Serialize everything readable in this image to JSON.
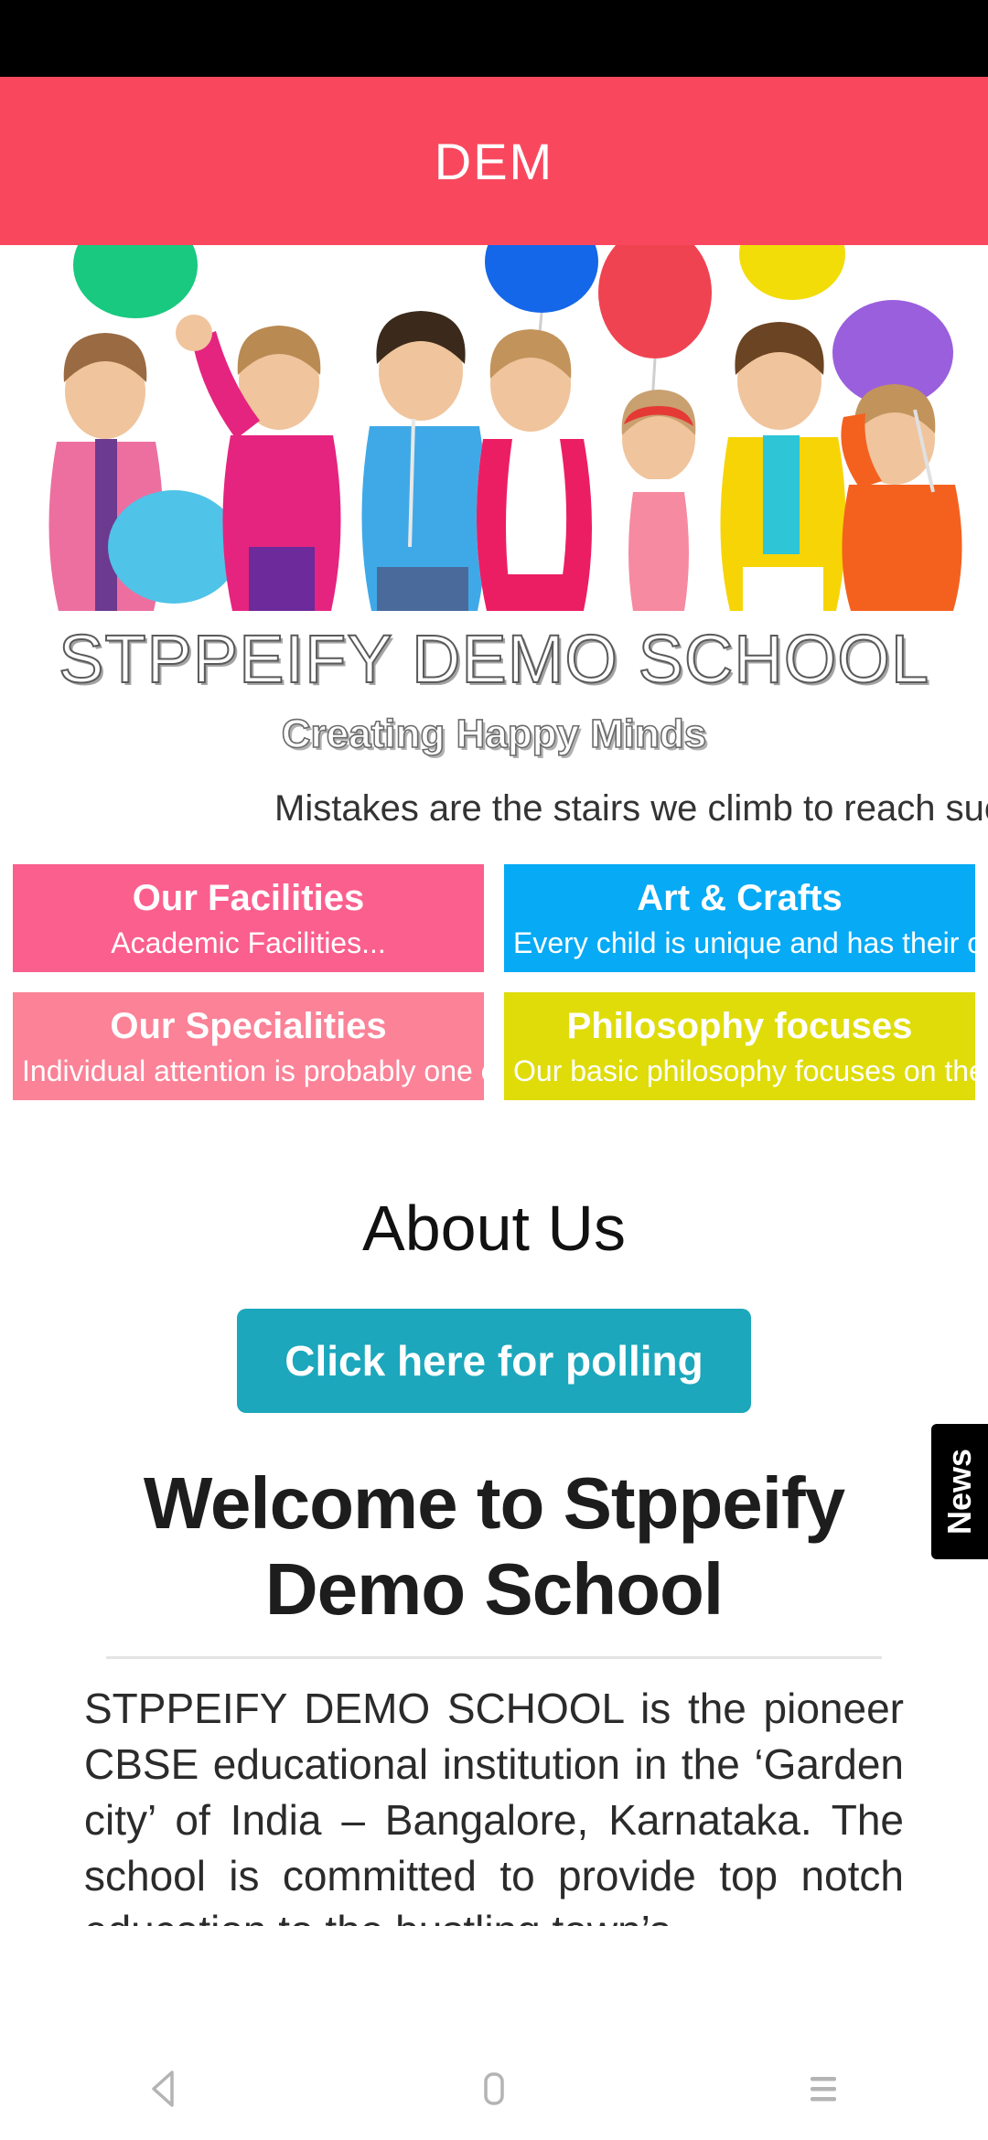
{
  "status_bar": {
    "present": true
  },
  "header": {
    "title": "DEM",
    "background_color": "#f9485e",
    "text_color": "#ffffff"
  },
  "banner": {
    "alt": "seven smiling children holding colorful balloons",
    "background_color": "#ffffff"
  },
  "identity": {
    "school_name": "STPPEIFY DEMO SCHOOL",
    "tagline": "Creating Happy Minds",
    "marquee": "Mistakes are the stairs we climb to reach suc"
  },
  "tiles": [
    {
      "title": "Our Facilities",
      "subtitle": "Academic Facilities...",
      "color": "#fb5f8e"
    },
    {
      "title": "Art & Crafts",
      "subtitle": "Every child is unique and has their ow",
      "color": "#06aaf5"
    },
    {
      "title": "Our Specialities",
      "subtitle": "Individual attention is probably one of",
      "color": "#fb8297"
    },
    {
      "title": "Philosophy focuses",
      "subtitle": "Our basic philosophy focuses on the s",
      "color": "#dfdc09"
    }
  ],
  "about": {
    "heading": "About Us",
    "poll_button": "Click here for polling",
    "poll_button_color": "#1ca7bc",
    "welcome_heading": "Welcome to Stppeify Demo School",
    "body": "STPPEIFY DEMO SCHOOL is the pioneer CBSE educational institution in the ‘Garden city’ of India – Bangalore, Karnataka. The school is committed to provide top notch education to the bustling town’s"
  },
  "news_tab": {
    "label": "News",
    "background_color": "#000000"
  },
  "nav_bar": {
    "back": "back-icon",
    "home": "home-icon",
    "recents": "recents-icon",
    "icon_color": "#b4b4b4"
  }
}
